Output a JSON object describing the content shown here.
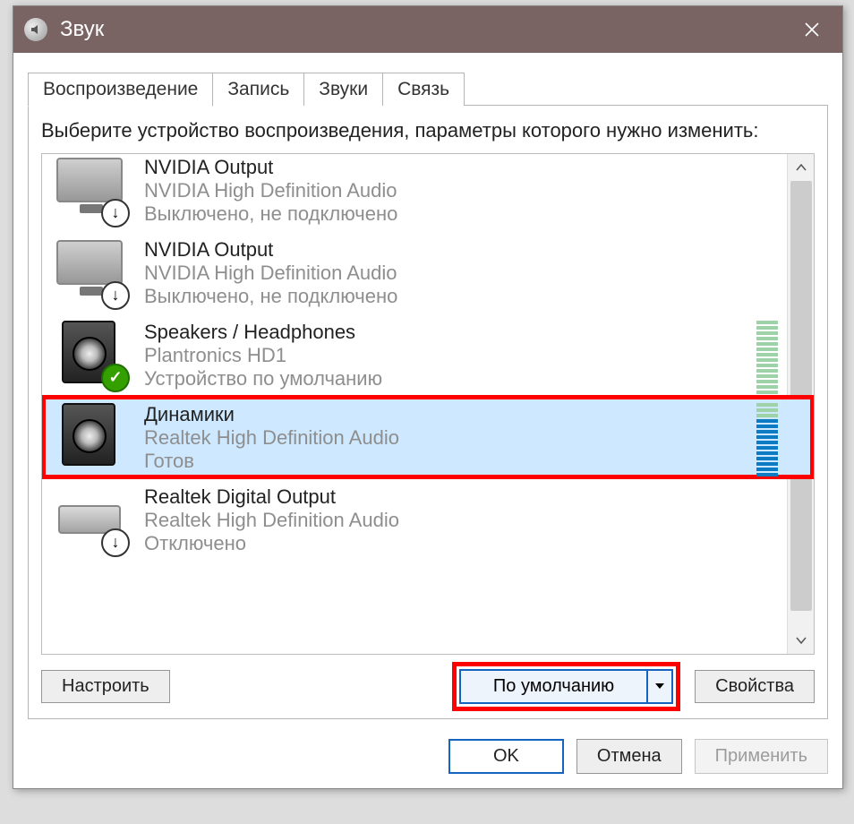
{
  "window": {
    "title": "Звук"
  },
  "tabs": [
    {
      "label": "Воспроизведение",
      "active": true
    },
    {
      "label": "Запись",
      "active": false
    },
    {
      "label": "Звуки",
      "active": false
    },
    {
      "label": "Связь",
      "active": false
    }
  ],
  "intro": "Выберите устройство воспроизведения, параметры которого нужно изменить:",
  "devices": [
    {
      "name": "NVIDIA Output",
      "desc": "NVIDIA High Definition Audio",
      "status": "Выключено, не подключено",
      "icon": "monitor",
      "overlay": "arrow",
      "selected": false,
      "highlight": false,
      "meter": null,
      "cutTop": true
    },
    {
      "name": "NVIDIA Output",
      "desc": "NVIDIA High Definition Audio",
      "status": "Выключено, не подключено",
      "icon": "monitor",
      "overlay": "arrow",
      "selected": false,
      "highlight": false,
      "meter": null
    },
    {
      "name": "Speakers / Headphones",
      "desc": "Plantronics HD1",
      "status": "Устройство по умолчанию",
      "icon": "speaker",
      "overlay": "check",
      "selected": false,
      "highlight": false,
      "meter": {
        "cells": 14,
        "active": 0,
        "color": "green"
      }
    },
    {
      "name": "Динамики",
      "desc": "Realtek High Definition Audio",
      "status": "Готов",
      "icon": "speaker",
      "overlay": null,
      "selected": true,
      "highlight": true,
      "meter": {
        "cells": 14,
        "active": 11,
        "color": "blue"
      }
    },
    {
      "name": "Realtek Digital Output",
      "desc": "Realtek High Definition Audio",
      "status": "Отключено",
      "icon": "digital",
      "overlay": "arrow",
      "selected": false,
      "highlight": false,
      "meter": null
    }
  ],
  "buttons": {
    "configure": "Настроить",
    "set_default": "По умолчанию",
    "set_default_highlight": true,
    "properties": "Свойства",
    "ok": "OK",
    "cancel": "Отмена",
    "apply": "Применить"
  }
}
